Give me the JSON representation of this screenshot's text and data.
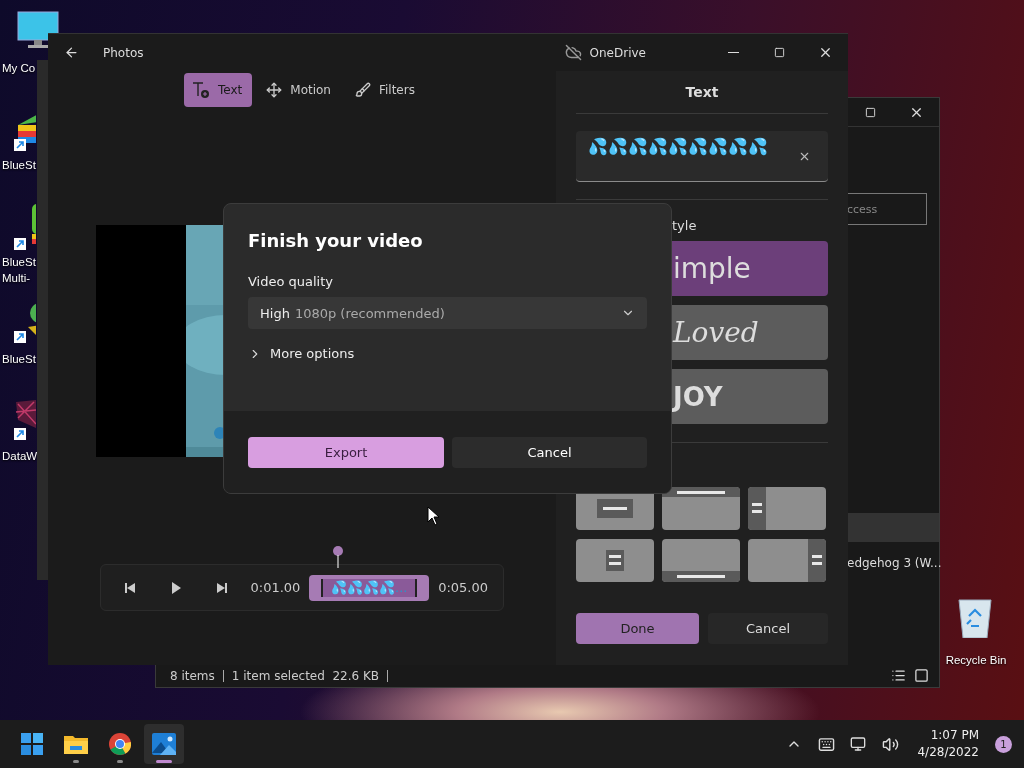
{
  "desktop_icons": [
    {
      "kind": "computer",
      "lines": [
        "My Co"
      ]
    },
    {
      "kind": "stack",
      "lines": [
        "BlueSt"
      ]
    },
    {
      "kind": "multi",
      "lines": [
        "BlueSt",
        "Multi-"
      ]
    },
    {
      "kind": "blob",
      "lines": [
        "BlueSt"
      ]
    },
    {
      "kind": "web",
      "lines": [
        "DataW"
      ]
    }
  ],
  "recycle_bin": {
    "label": "Recycle Bin"
  },
  "explorer": {
    "search_placeholder": "ccess",
    "file_name": "edgehog 3 (W...",
    "status": [
      "8 items",
      "1 item selected  22.6 KB"
    ]
  },
  "photos": {
    "title": "Photos",
    "onedrive": "OneDrive",
    "tools": [
      {
        "kind": "text",
        "label": "Text",
        "selected": true
      },
      {
        "kind": "motion",
        "label": "Motion",
        "selected": false
      },
      {
        "kind": "filters",
        "label": "Filters",
        "selected": false
      }
    ],
    "timeline": {
      "start": "0:01.00",
      "clip": "💦💦💦💦...",
      "end": "0:05.00"
    }
  },
  "text_panel": {
    "title": "Text",
    "value": "💦💦💦💦💦💦💦💦💦",
    "styles_label": "tyle",
    "styles": [
      {
        "kind": "simple",
        "label": "imple",
        "selected": true
      },
      {
        "kind": "script",
        "label": "Loved",
        "selected": false
      },
      {
        "kind": "bold",
        "label": "JOY",
        "selected": false
      }
    ],
    "layouts": [
      {
        "kind": "center"
      },
      {
        "kind": "top"
      },
      {
        "kind": "left"
      },
      {
        "kind": "middle"
      },
      {
        "kind": "bottom"
      },
      {
        "kind": "right"
      }
    ],
    "done": "Done",
    "cancel": "Cancel"
  },
  "dialog": {
    "title": "Finish your video",
    "quality_label": "Video quality",
    "quality_value": "High",
    "quality_detail": "1080p (recommended)",
    "more_options": "More options",
    "export": "Export",
    "cancel": "Cancel"
  },
  "taskbar": {
    "apps": [
      {
        "kind": "start",
        "selected": false,
        "running": false
      },
      {
        "kind": "explorer",
        "selected": false,
        "running": true
      },
      {
        "kind": "chrome",
        "selected": false,
        "running": true
      },
      {
        "kind": "photos",
        "selected": true,
        "running": true
      }
    ],
    "time": "1:07 PM",
    "date": "4/28/2022",
    "notifications": "1"
  }
}
